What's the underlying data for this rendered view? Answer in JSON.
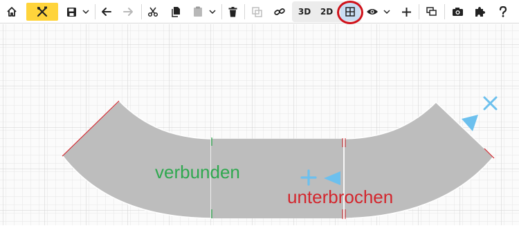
{
  "toolbar": {
    "view_3d_label": "3D",
    "view_2d_label": "2D",
    "colors": {
      "highlight": "#ffd43b",
      "grid_button_active": "#c9ddf3",
      "annotation_circle": "#d0121b",
      "icon": "#222222"
    },
    "icons": [
      "home-icon",
      "tools-icon",
      "save-icon",
      "chevron-down-icon",
      "undo-arrow-icon",
      "redo-arrow-icon",
      "cut-icon",
      "copy-icon",
      "paste-icon",
      "trash-icon",
      "duplicate-icon",
      "link-icon",
      "grid-icon",
      "eye-icon",
      "plus-icon",
      "layers-icon",
      "camera-icon",
      "puzzle-icon",
      "help-icon"
    ]
  },
  "canvas": {
    "label_connected": "verbunden",
    "label_interrupted": "unterbrochen",
    "colors": {
      "grid_minor": "#e6e6e6",
      "grid_major": "#cfcfcf",
      "track": "#bdbdbd",
      "connected": "#2fa84f",
      "interrupted": "#d3262d",
      "marker": "#6cc0ee"
    }
  }
}
